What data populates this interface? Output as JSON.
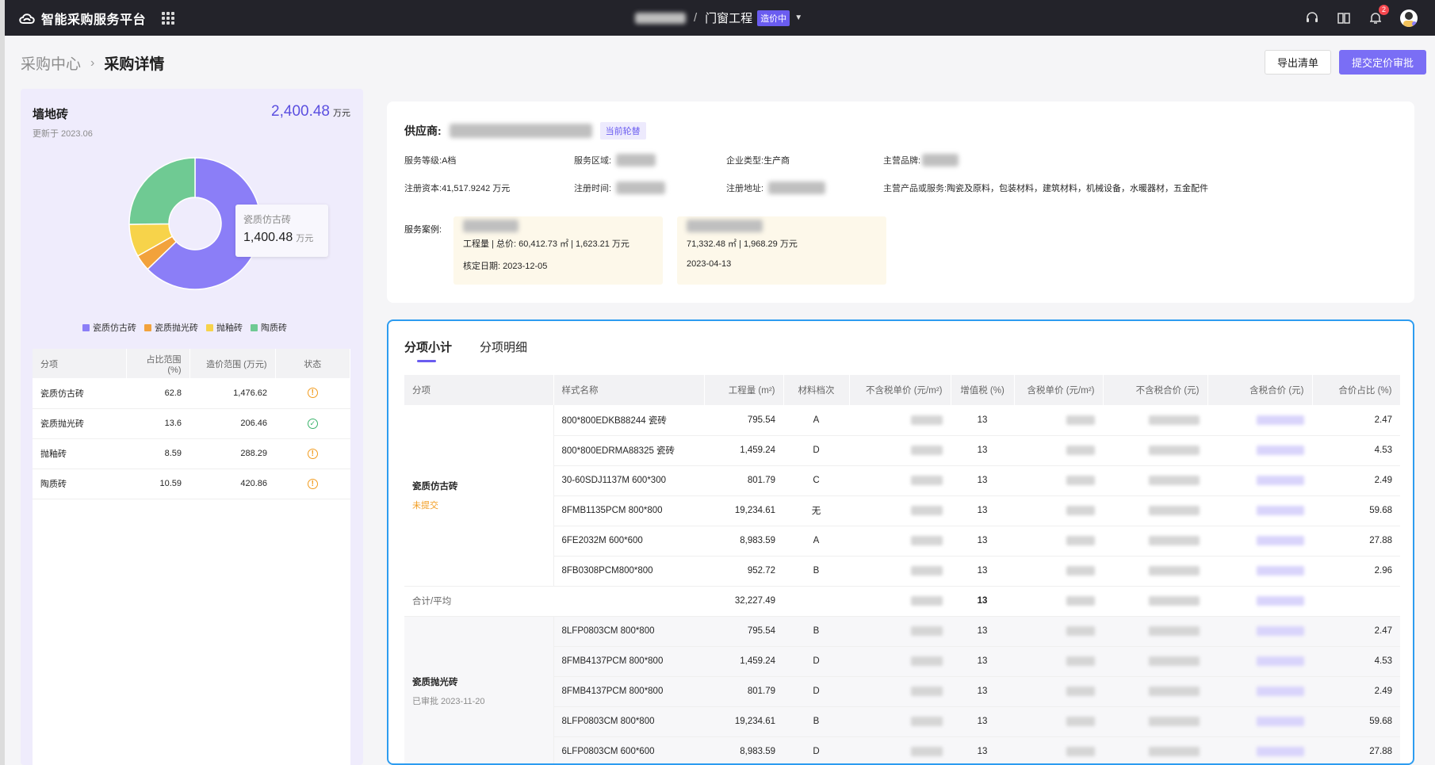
{
  "app": {
    "name": "智能采购服务平台"
  },
  "topbar": {
    "project": "门窗工程",
    "project_status": "造价中",
    "notification_count": "2"
  },
  "page": {
    "breadcrumb_parent": "采购中心",
    "breadcrumb_current": "采购详情",
    "export_label": "导出清单",
    "submit_label": "提交定价审批"
  },
  "summary": {
    "title": "墙地砖",
    "updated": "更新于 2023.06",
    "total": "2,400.48",
    "total_unit": "万元",
    "tooltip_label": "瓷质仿古砖",
    "tooltip_value": "1,400.48",
    "tooltip_unit": "万元",
    "legend": [
      "瓷质仿古砖",
      "瓷质抛光砖",
      "抛釉砖",
      "陶质砖"
    ],
    "colors": {
      "瓷质仿古砖": "#8b7ef7",
      "瓷质抛光砖": "#f2a23c",
      "抛釉砖": "#f7d34a",
      "陶质砖": "#6fca93"
    },
    "table_headers": [
      "分项",
      "占比范围 (%)",
      "造价范围 (万元)",
      "状态"
    ],
    "rows": [
      {
        "name": "瓷质仿古砖",
        "pct": "62.8",
        "price": "1,476.62",
        "status": "!"
      },
      {
        "name": "瓷质抛光砖",
        "pct": "13.6",
        "price": "206.46",
        "status": "✓"
      },
      {
        "name": "抛釉砖",
        "pct": "8.59",
        "price": "288.29",
        "status": "!"
      },
      {
        "name": "陶质砖",
        "pct": "10.59",
        "price": "420.86",
        "status": "!"
      }
    ]
  },
  "chart_data": {
    "type": "pie",
    "categories": [
      "瓷质仿古砖",
      "瓷质抛光砖",
      "抛釉砖",
      "陶质砖"
    ],
    "values": [
      62.8,
      4.0,
      8.0,
      25.2
    ]
  },
  "supplier": {
    "label": "供应商:",
    "tag": "当前轮替",
    "service_level_k": "服务等级:",
    "service_level_v": "A档",
    "service_area_k": "服务区域:",
    "company_type_k": "企业类型:",
    "company_type_v": "生产商",
    "brand_k": "主营品牌:",
    "capital_k": "注册资本:",
    "capital_v": "41,517.9242 万元",
    "reg_time_k": "注册时间:",
    "reg_addr_k": "注册地址:",
    "products_k": "主营产品或服务:",
    "products_v": "陶瓷及原料，包装材料，建筑材料，机械设备，水暖器材，五金配件",
    "cases_label": "服务案例:",
    "case1_line1": "工程量 | 总价:  60,412.73 ㎡ | 1,623.21 万元",
    "case1_line2": "核定日期:  2023-12-05",
    "case2_line1": "71,332.48 ㎡ | 1,968.29 万元",
    "case2_line2": "2023-04-13"
  },
  "detail": {
    "tabs": [
      "分项小计",
      "分项明细"
    ],
    "headers": [
      "分项",
      "样式名称",
      "工程量 (m²)",
      "材料档次",
      "不含税单价 (元/m²)",
      "增值税 (%)",
      "含税单价 (元/m²)",
      "不含税合价 (元)",
      "含税合价 (元)",
      "合价占比 (%)"
    ],
    "group1": {
      "name": "瓷质仿古砖",
      "status": "未提交",
      "rows": [
        {
          "style": "800*800EDKB88244 瓷砖",
          "qty": "795.54",
          "grade": "A",
          "vat": "13",
          "ratio": "2.47"
        },
        {
          "style": "800*800EDRMA88325 瓷砖",
          "qty": "1,459.24",
          "grade": "D",
          "vat": "13",
          "ratio": "4.53"
        },
        {
          "style": "30-60SDJ1137M 600*300",
          "qty": "801.79",
          "grade": "C",
          "vat": "13",
          "ratio": "2.49"
        },
        {
          "style": "8FMB1135PCM 800*800",
          "qty": "19,234.61",
          "grade": "无",
          "vat": "13",
          "ratio": "59.68"
        },
        {
          "style": "6FE2032M 600*600",
          "qty": "8,983.59",
          "grade": "A",
          "vat": "13",
          "ratio": "27.88"
        },
        {
          "style": "8FB0308PCM800*800",
          "qty": "952.72",
          "grade": "B",
          "vat": "13",
          "ratio": "2.96"
        }
      ],
      "sum_label": "合计/平均",
      "sum_qty": "32,227.49",
      "sum_vat": "13"
    },
    "group2": {
      "name": "瓷质抛光砖",
      "status": "已审批 2023-11-20",
      "rows": [
        {
          "style": "8LFP0803CM 800*800",
          "qty": "795.54",
          "grade": "B",
          "vat": "13",
          "ratio": "2.47"
        },
        {
          "style": "8FMB4137PCM 800*800",
          "qty": "1,459.24",
          "grade": "D",
          "vat": "13",
          "ratio": "4.53"
        },
        {
          "style": "8FMB4137PCM 800*800",
          "qty": "801.79",
          "grade": "D",
          "vat": "13",
          "ratio": "2.49"
        },
        {
          "style": "8LFP0803CM 800*800",
          "qty": "19,234.61",
          "grade": "B",
          "vat": "13",
          "ratio": "59.68"
        },
        {
          "style": "6LFP0803CM 600*600",
          "qty": "8,983.59",
          "grade": "D",
          "vat": "13",
          "ratio": "27.88"
        }
      ]
    }
  }
}
